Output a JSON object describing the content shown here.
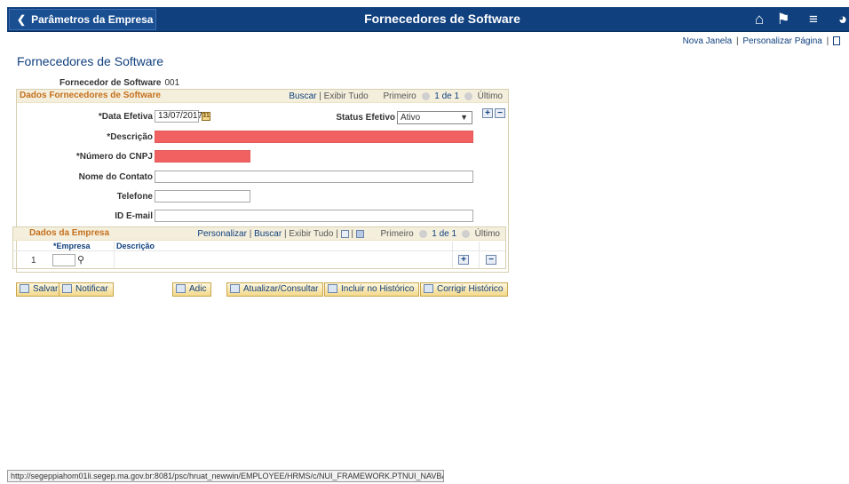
{
  "topbar": {
    "back_label": "Parâmetros da Empresa",
    "title": "Fornecedores de Software",
    "icons": [
      "home-icon",
      "flag-icon",
      "menu-icon",
      "navbar-icon"
    ]
  },
  "utility": {
    "new_window": "Nova Janela",
    "sep": "|",
    "personalize": "Personalizar Página"
  },
  "page_title": "Fornecedores de Software",
  "key": {
    "label": "Fornecedor de Software",
    "value": "001"
  },
  "section": {
    "title": "Dados Fornecedores de Software",
    "find": "Buscar",
    "view_all": "Exibir Tudo",
    "first": "Primeiro",
    "count": "1 de 1",
    "last": "Último",
    "fields": {
      "eff_date_label": "*Data Efetiva",
      "eff_date_value": "13/07/2017",
      "status_label": "Status Efetivo",
      "status_value": "Ativo",
      "description_label": "*Descrição",
      "description_value": "",
      "cnpj_label": "*Número do CNPJ",
      "cnpj_value": "",
      "contact_label": "Nome do Contato",
      "contact_value": "",
      "phone_label": "Telefone",
      "phone_value": "",
      "email_label": "ID E-mail",
      "email_value": ""
    }
  },
  "grid": {
    "title": "Dados da Empresa",
    "personalize": "Personalizar",
    "find": "Buscar",
    "view_all": "Exibir Tudo",
    "first": "Primeiro",
    "count": "1 de 1",
    "last": "Último",
    "columns": [
      "*Empresa",
      "Descrição"
    ],
    "rows": [
      {
        "num": "1",
        "empresa": "",
        "descricao": ""
      }
    ]
  },
  "toolbar": {
    "save": "Salvar",
    "notify": "Notificar",
    "add": "Adic",
    "update": "Atualizar/Consultar",
    "include_history": "Incluir no Histórico",
    "correct_history": "Corrigir Histórico"
  },
  "status_url": "http://segeppiahom01li.segep.ma.gov.br:8081/psc/hruat_newwin/EMPLOYEE/HRMS/c/NUI_FRAMEWORK.PTNUI_NAVBAR.GBL"
}
